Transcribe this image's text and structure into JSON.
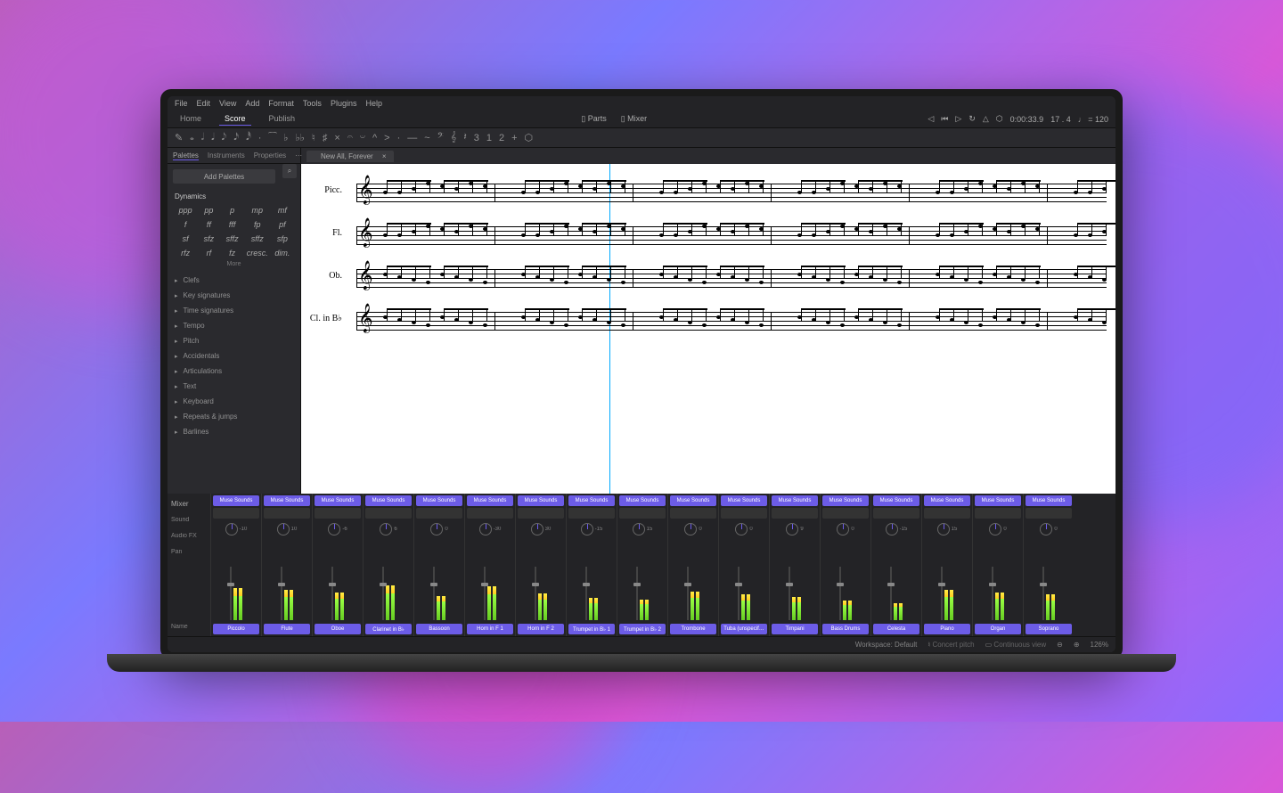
{
  "menubar": [
    "File",
    "Edit",
    "View",
    "Add",
    "Format",
    "Tools",
    "Plugins",
    "Help"
  ],
  "tabs": {
    "items": [
      "Home",
      "Score",
      "Publish"
    ],
    "active": 1,
    "center": [
      "Parts",
      "Mixer"
    ],
    "right": {
      "time": "0:00:33.9",
      "beat": "17 . 4",
      "tempo": "♩ = 120"
    }
  },
  "toolbar": [
    "✎",
    "𝅝",
    "𝅗𝅥",
    "𝅘𝅥",
    "𝅘𝅥𝅮",
    "𝅘𝅥𝅯",
    "𝅘𝅥𝅰",
    "·",
    "⁀",
    "♭",
    "♭♭",
    "♮",
    "♯",
    "×",
    "𝄐",
    "𝄑",
    "^",
    ">",
    "·",
    "—",
    "~",
    "𝄢",
    "𝄞",
    "𝄽",
    "3",
    "1",
    "2",
    "+",
    "⬡"
  ],
  "sidebar": {
    "tabs": [
      "Palettes",
      "Instruments",
      "Properties"
    ],
    "addPalettes": "Add Palettes",
    "dynamics": {
      "title": "Dynamics",
      "items": [
        "ppp",
        "pp",
        "p",
        "mp",
        "mf",
        "f",
        "ff",
        "fff",
        "fp",
        "pf",
        "sf",
        "sfz",
        "sffz",
        "sffz",
        "sfp",
        "rfz",
        "rf",
        "fz",
        "cresc.",
        "dim."
      ]
    },
    "more": "More",
    "categories": [
      "Clefs",
      "Key signatures",
      "Time signatures",
      "Tempo",
      "Pitch",
      "Accidentals",
      "Articulations",
      "Text",
      "Keyboard",
      "Repeats & jumps",
      "Barlines"
    ]
  },
  "docTab": "New All, Forever",
  "staves": [
    {
      "label": "Picc."
    },
    {
      "label": "Fl."
    },
    {
      "label": "Ob."
    },
    {
      "label": "Cl. in B♭"
    }
  ],
  "mixer": {
    "title": "Mixer",
    "rows": [
      "Sound",
      "Audio FX",
      "Pan"
    ],
    "nameRow": "Name",
    "soundLabel": "Muse Sounds",
    "channels": [
      {
        "name": "Piccolo",
        "pan": -10,
        "level": 55
      },
      {
        "name": "Flute",
        "pan": 10,
        "level": 52
      },
      {
        "name": "Oboe",
        "pan": -6,
        "level": 48
      },
      {
        "name": "Clarinet in B♭",
        "pan": 6,
        "level": 60
      },
      {
        "name": "Bassoon",
        "pan": 0,
        "level": 42
      },
      {
        "name": "Horn in F 1",
        "pan": -30,
        "level": 58
      },
      {
        "name": "Horn in F 2",
        "pan": 30,
        "level": 46
      },
      {
        "name": "Trumpet in B♭ 1",
        "pan": -15,
        "level": 38
      },
      {
        "name": "Trumpet in B♭ 2",
        "pan": 15,
        "level": 36
      },
      {
        "name": "Trombone",
        "pan": 0,
        "level": 50
      },
      {
        "name": "Tuba (unspecif…",
        "pan": 0,
        "level": 44
      },
      {
        "name": "Timpani",
        "pan": 9,
        "level": 40
      },
      {
        "name": "Bass Drums",
        "pan": 0,
        "level": 34
      },
      {
        "name": "Celesta",
        "pan": -15,
        "level": 30
      },
      {
        "name": "Piano",
        "pan": 15,
        "level": 52
      },
      {
        "name": "Organ",
        "pan": 0,
        "level": 48
      },
      {
        "name": "Soprano",
        "pan": 0,
        "level": 44
      }
    ]
  },
  "statusbar": {
    "workspace": "Workspace: Default",
    "concert": "Concert pitch",
    "view": "Continuous view",
    "zoom": "126%"
  }
}
